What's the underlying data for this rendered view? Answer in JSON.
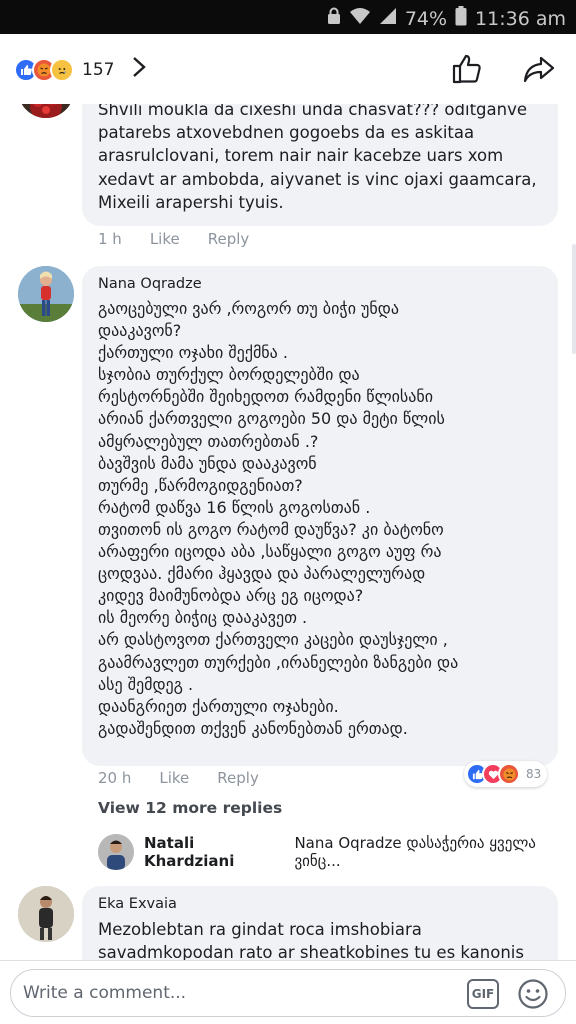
{
  "status_bar": {
    "battery": "74%",
    "time": "11:36 am"
  },
  "post_header": {
    "reaction_count": "157",
    "reactions": [
      "like",
      "angry",
      "sad"
    ]
  },
  "comments": [
    {
      "text": "Shvili moukla da cixeshi unda chasvat??? oditganve patarebs atxovebdnen gogoebs da es askitaa arasrulclovani, torem nair nair kacebze uars xom xedavt ar ambobda, aiyvanet is vinc ojaxi gaamcara, Mixeili arapershi tyuis.",
      "time": "1 h",
      "like": "Like",
      "reply": "Reply"
    },
    {
      "name": "Nana Oqradze",
      "text": "გაოცებული ვარ ,როგორ თუ ბიჭი უნდა\nდააკავონ?\nქართული ოჯახი შექმნა .\nსჯობია თურქულ ბორდელებში და\nრესტორნებში შეიხედოთ რამდენი წლისანი\nარიან ქართველი გოგოები  50 და მეტი წლის\nამყრალებულ თათრებთან .?\nბავშვის მამა უნდა დააკავონ\nთურმე ,წარმოგიდგენიათ?\nრატომ დაწვა 16 წლის გოგოსთან .\nთვითონ ის გოგო რატომ დაუწვა? კი ბატონო\nარაფერი იცოდა აბა ,საწყალი გოგო აუფ რა\nცოდვაა. ქმარი ჰყავდა და პარალელურად\nკიდევ მაიმუნობდა არც ეგ იცოდა?\nის მეორე ბიჭიც დააკავეთ .\nარ დასტოვოთ ქართველი კაცები დაუსჯელი ,\nგაამრავლეთ თურქები ,ირანელები ზანგები და\nასე შემდეგ .\nდაანგრიეთ ქართული ოჯახები.\nგადაშენდით თქვენ კანონებთან ერთად.",
      "time": "20 h",
      "like": "Like",
      "reply": "Reply",
      "reaction_count": "83",
      "more_replies": "View 12 more replies",
      "reply_preview": {
        "name": "Natali Khardziani",
        "text": "Nana Oqradze დასაჭერია ყველა ვინც..."
      }
    },
    {
      "name": "Eka Exvaia",
      "text": "Mezoblebtan ra gindat roca imshobiara\nsavadmkopodan rato ar sheatkobines tu es kanonis"
    }
  ],
  "composer": {
    "placeholder": "Write a comment...",
    "gif_label": "GIF"
  }
}
